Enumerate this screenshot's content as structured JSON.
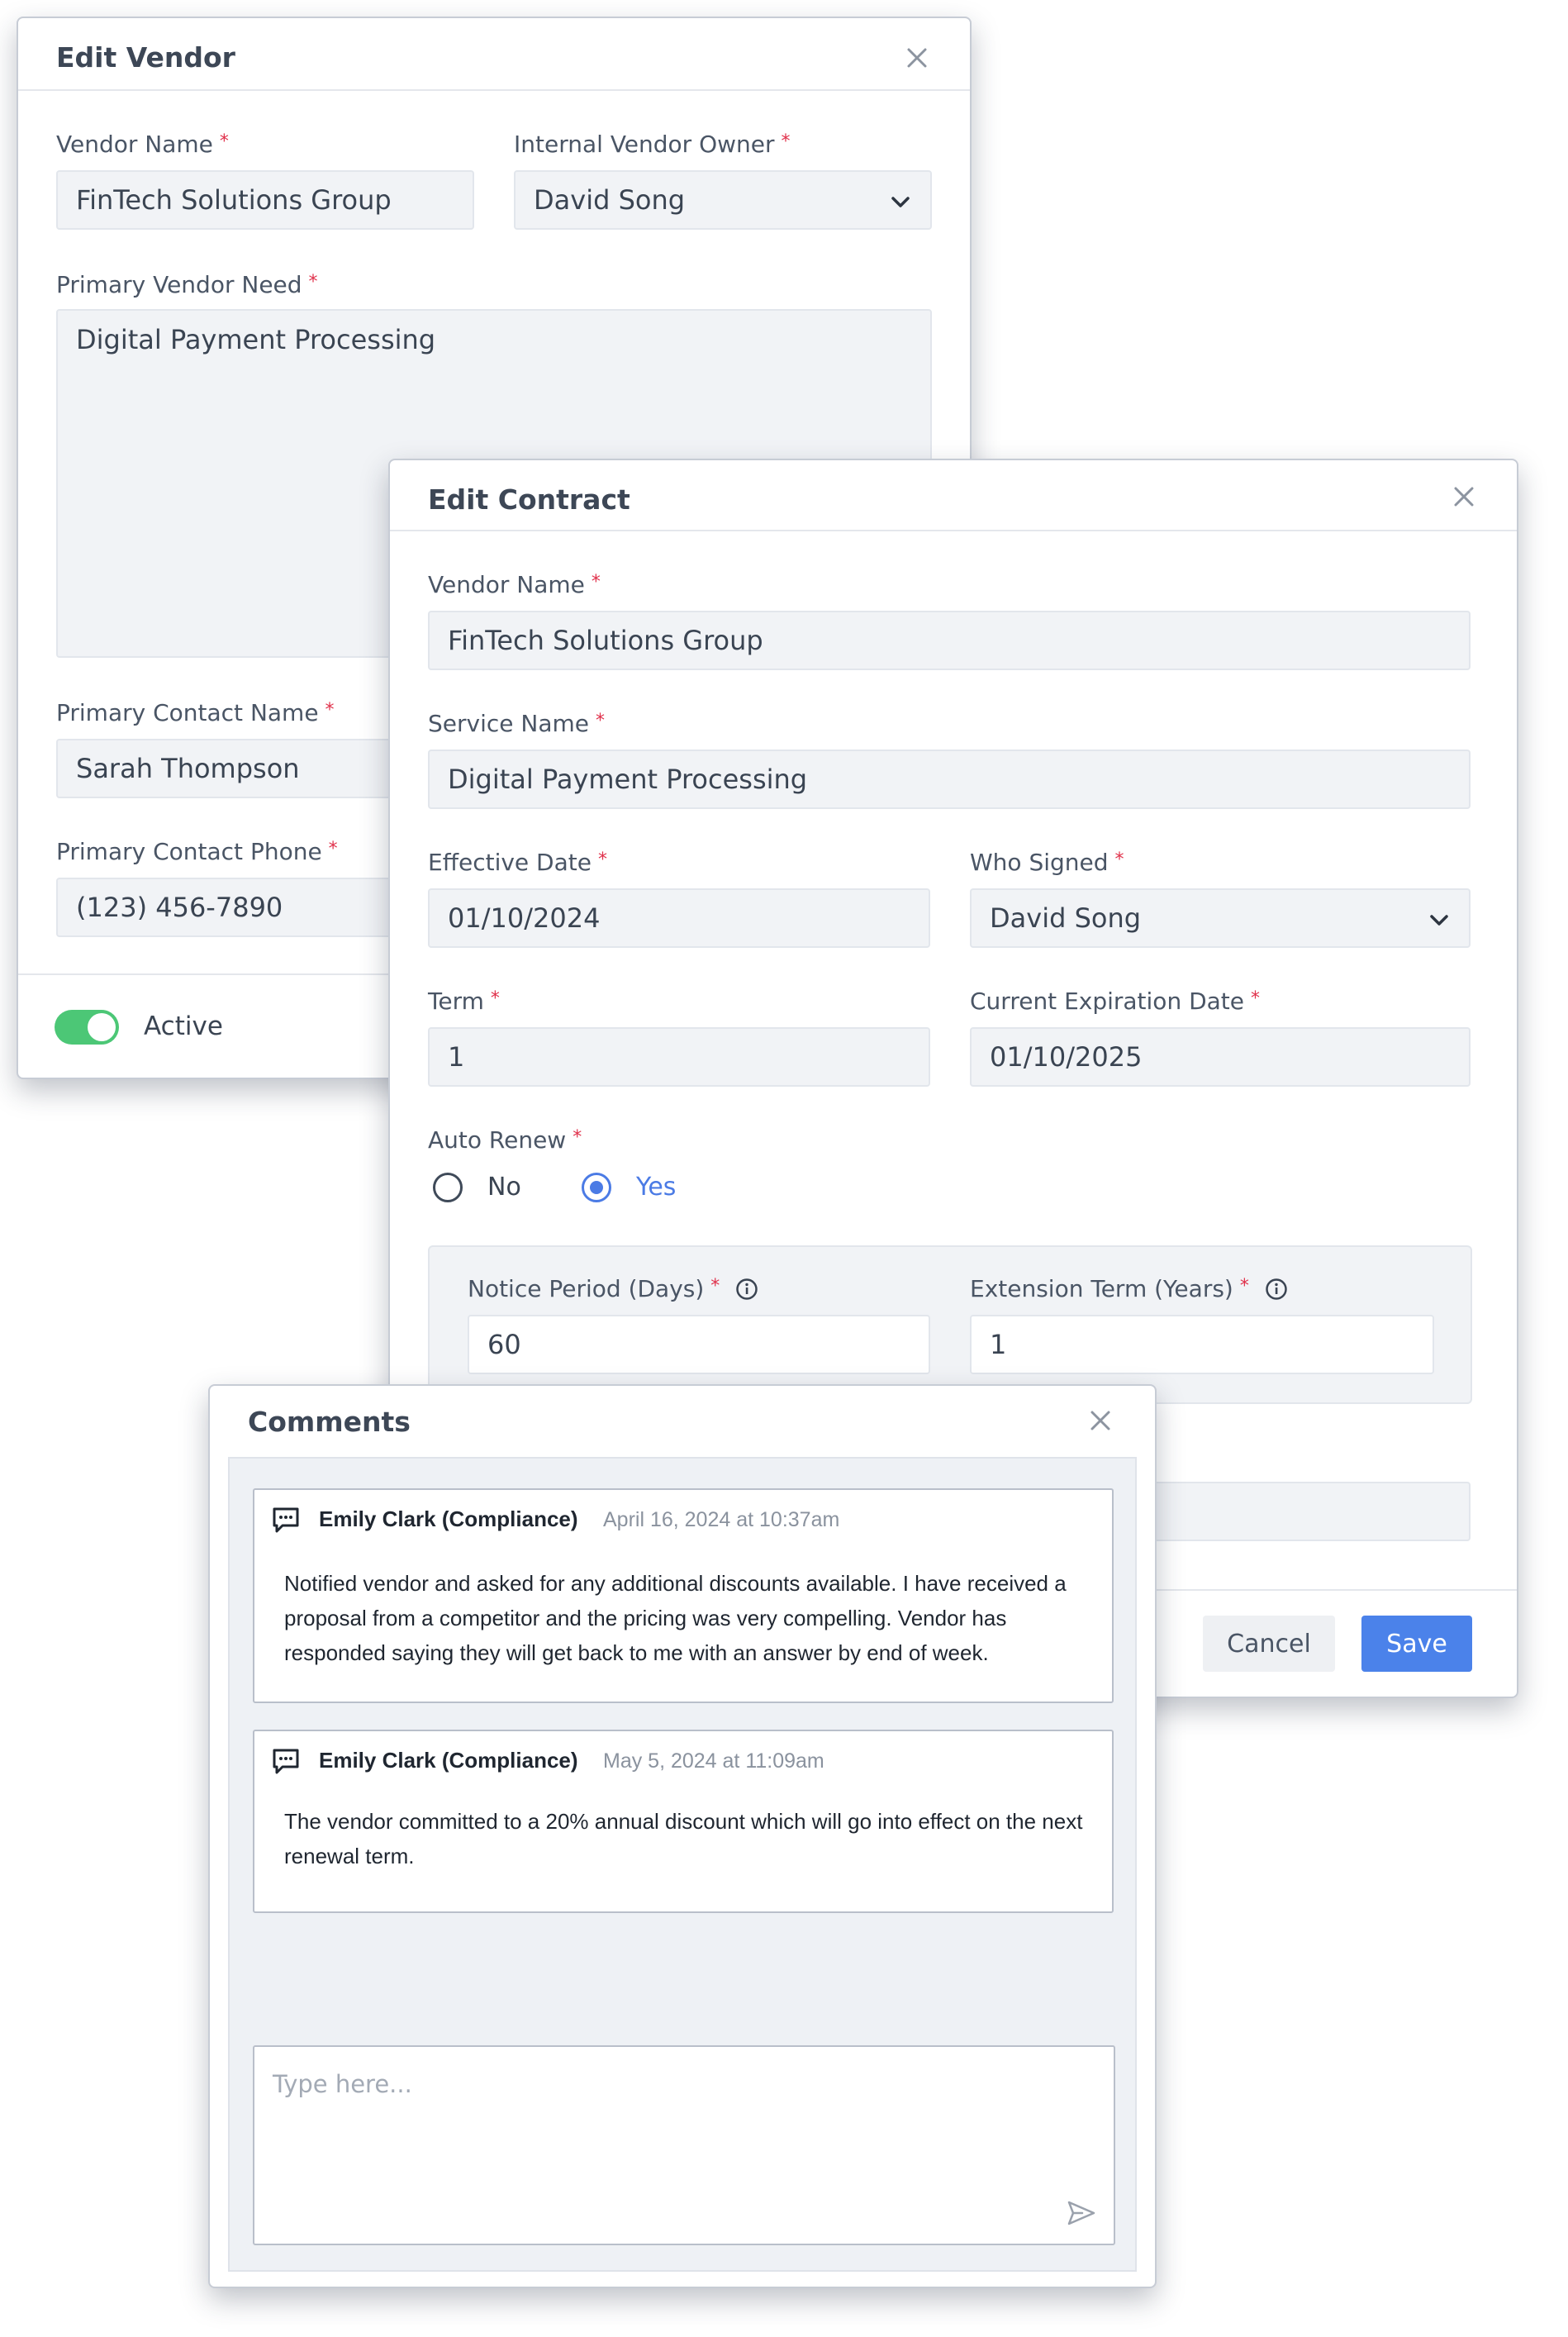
{
  "vendor_dialog": {
    "title": "Edit Vendor",
    "vendor_name": {
      "label": "Vendor Name",
      "value": "FinTech Solutions Group"
    },
    "owner": {
      "label": "Internal Vendor Owner",
      "value": "David Song"
    },
    "need": {
      "label": "Primary Vendor Need",
      "value": "Digital Payment Processing"
    },
    "contact_name": {
      "label": "Primary Contact Name",
      "value": "Sarah Thompson"
    },
    "contact_phone": {
      "label": "Primary Contact Phone",
      "value": "(123) 456-7890"
    },
    "active": {
      "label": "Active",
      "on": true
    }
  },
  "contract_dialog": {
    "title": "Edit Contract",
    "vendor_name": {
      "label": "Vendor Name",
      "value": "FinTech Solutions Group"
    },
    "service_name": {
      "label": "Service Name",
      "value": "Digital Payment Processing"
    },
    "effective_date": {
      "label": "Effective Date",
      "value": "01/10/2024"
    },
    "who_signed": {
      "label": "Who Signed",
      "value": "David Song"
    },
    "term": {
      "label": "Term",
      "value": "1"
    },
    "expiration": {
      "label": "Current Expiration Date",
      "value": "01/10/2025"
    },
    "auto_renew": {
      "label": "Auto Renew",
      "options": [
        "No",
        "Yes"
      ],
      "selected": "Yes"
    },
    "notice_period": {
      "label": "Notice Period (Days)",
      "value": "60"
    },
    "extension_term": {
      "label": "Extension Term (Years)",
      "value": "1"
    },
    "cancel_label": "Cancel",
    "save_label": "Save"
  },
  "comments_dialog": {
    "title": "Comments",
    "comments": [
      {
        "author": "Emily Clark (Compliance)",
        "time": "April 16, 2024 at 10:37am",
        "text": "Notified vendor and asked for any additional discounts available.  I have received a proposal from a competitor and the pricing was very compelling.  Vendor has responded saying they will get back to me with an answer by end of week."
      },
      {
        "author": "Emily Clark (Compliance)",
        "time": "May 5, 2024 at 11:09am",
        "text": "The vendor committed to a 20% annual discount which will go into effect on the next renewal term."
      }
    ],
    "reply_placeholder": "Type here..."
  },
  "colors": {
    "primary": "#4b82ea",
    "toggle_on": "#4cc776",
    "required": "#e0314b"
  }
}
